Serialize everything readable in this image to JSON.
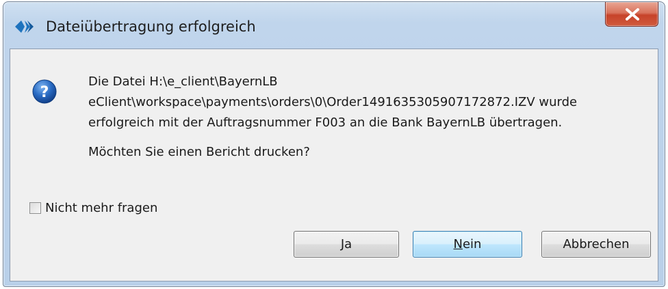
{
  "window": {
    "title": "Dateiübertragung erfolgreich",
    "icon": "app-logo-icon",
    "close_icon": "close-icon"
  },
  "dialog": {
    "icon": "question-icon",
    "message_lines": [
      "Die Datei H:\\e_client\\BayernLB",
      "eClient\\workspace\\payments\\orders\\0\\Order1491635305907172872.IZV wurde",
      "erfolgreich mit der Auftragsnummer F003 an die Bank BayernLB übertragen."
    ],
    "question": "Möchten Sie einen Bericht drucken?",
    "checkbox_label": "Nicht mehr fragen"
  },
  "buttons": {
    "yes": "Ja",
    "no": "Nein",
    "cancel": "Abbrechen"
  },
  "colors": {
    "frame": "#c0d5ec",
    "close_red": "#c7432a",
    "focus_blue": "#3c7fb1",
    "icon_blue": "#2a6cc4"
  }
}
